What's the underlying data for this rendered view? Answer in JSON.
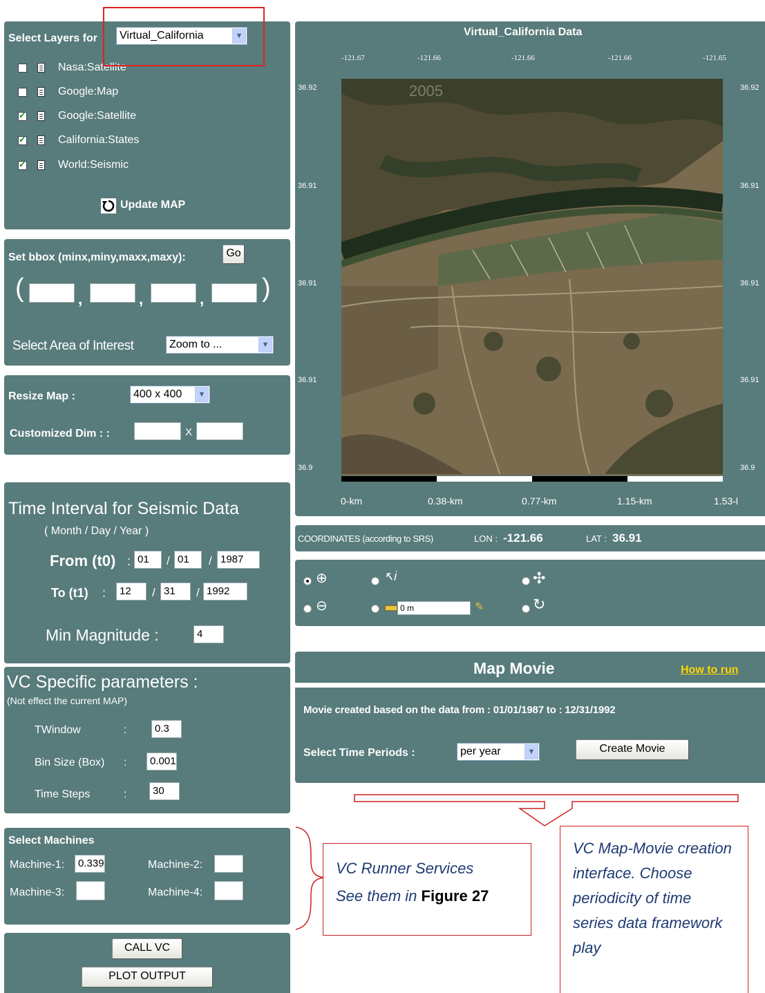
{
  "layers_panel": {
    "label": "Select Layers for",
    "selected": "Virtual_California",
    "layers": [
      {
        "label": "Nasa:Satellite",
        "checked": false
      },
      {
        "label": "Google:Map",
        "checked": false
      },
      {
        "label": "Google:Satellite",
        "checked": true
      },
      {
        "label": "California:States",
        "checked": true
      },
      {
        "label": "World:Seismic",
        "checked": true
      }
    ],
    "update_label": "Update MAP"
  },
  "bbox_panel": {
    "label": "Set bbox (minx,miny,maxx,maxy):",
    "go_label": "Go",
    "open_paren": "(",
    "close_paren": ")",
    "comma": ",",
    "area_label": "Select Area of Interest",
    "area_selected": "Zoom to ..."
  },
  "resize_panel": {
    "label": "Resize Map :",
    "size_selected": "400 x 400",
    "custom_label": "Customized Dim : :",
    "x_label": "X"
  },
  "time_panel": {
    "title": "Time Interval for Seismic Data",
    "subtitle": "( Month / Day / Year )",
    "from_label": "From (t0)",
    "to_label": "To (t1)",
    "colon": ":",
    "slash": "/",
    "from": {
      "month": "01",
      "day": "01",
      "year": "1987"
    },
    "to": {
      "month": "12",
      "day": "31",
      "year": "1992"
    },
    "min_mag_label": "Min Magnitude :",
    "min_mag_value": "4"
  },
  "vc_panel": {
    "title": "VC Specific parameters :",
    "subtitle": "(Not effect the current MAP)",
    "colon": ":",
    "twindow_label": "TWindow",
    "twindow_value": "0.3",
    "binsize_label": "Bin Size (Box)",
    "binsize_value": "0.001",
    "timesteps_label": "Time Steps",
    "timesteps_value": "30"
  },
  "machines_panel": {
    "title": "Select Machines",
    "m1_label": "Machine-1:",
    "m1_value": "0.339",
    "m2_label": "Machine-2:",
    "m2_value": "",
    "m3_label": "Machine-3:",
    "m3_value": "",
    "m4_label": "Machine-4:",
    "m4_value": ""
  },
  "action_buttons": {
    "call_vc": "CALL VC",
    "plot_output": "PLOT OUTPUT"
  },
  "map_panel": {
    "title": "Virtual_California Data",
    "lon_ticks": [
      "-121.67",
      "-121.66",
      "-121.66",
      "-121.66",
      "-121.65"
    ],
    "lat_ticks": [
      "36.92",
      "36.91",
      "36.91",
      "36.91",
      "36.9"
    ],
    "watermark": "2005",
    "scale_labels": [
      "0-km",
      "0.38-km",
      "0.77-km",
      "1.15-km",
      "1.53-l"
    ]
  },
  "coords_bar": {
    "label": "COORDINATES (according to SRS)",
    "lon_label": "LON :",
    "lon_value": "-121.66",
    "lat_label": "LAT :",
    "lat_value": "36.91"
  },
  "tools": {
    "measure_value": "0 m"
  },
  "movie": {
    "title": "Map Movie",
    "how_to": "How to run",
    "created_text": "Movie created based on the data from : 01/01/1987 to : 12/31/1992",
    "period_label": "Select Time Periods :",
    "period_selected": "per year",
    "create_label": "Create Movie"
  },
  "callouts": {
    "runner_line1": "VC Runner Services",
    "runner_line2": "See them in",
    "runner_fig": "Figure 27",
    "movie_text": "VC Map-Movie creation interface. Choose periodicity of time series data framework play"
  },
  "colors": {
    "panel": "#587b7b",
    "callout_border": "#cc2222",
    "callout_text": "#1f3b73"
  }
}
